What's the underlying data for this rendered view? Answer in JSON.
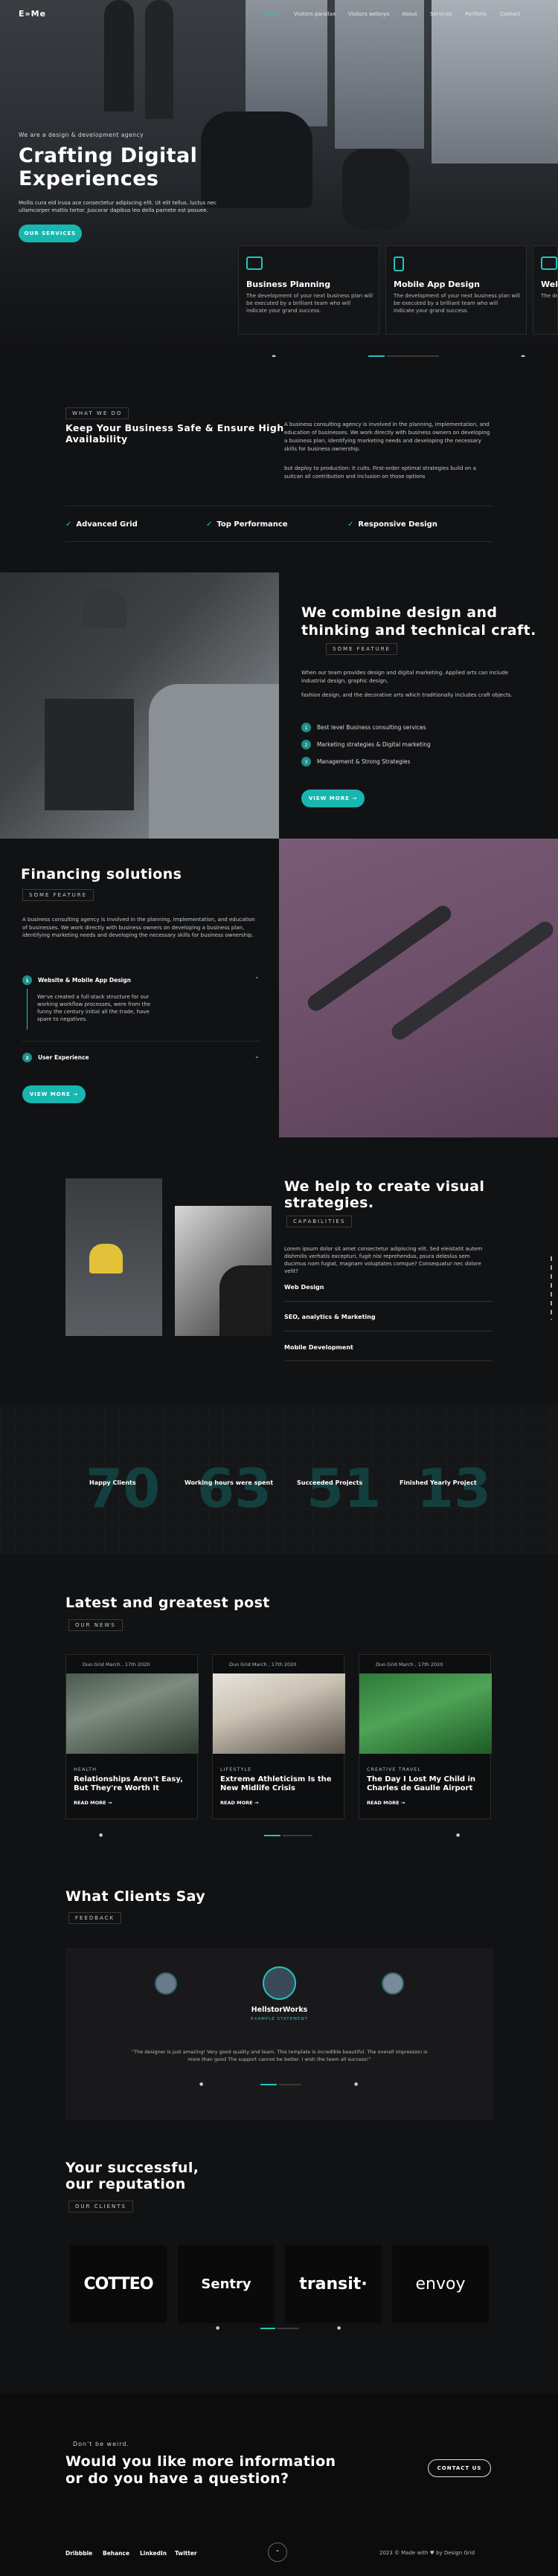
{
  "header": {
    "logo": "E»Me",
    "nav": [
      "Home",
      "Visitors parallax",
      "Visitors webnya",
      "About",
      "Services",
      "Portfolio",
      "Contact"
    ]
  },
  "hero": {
    "kicker": "We are a design & development agency",
    "title_l1": "Crafting Digital",
    "title_l2": "Experiences",
    "text_l1": "Mollis cura eid irusa ace consectetur adipiscing elit. Ut elit tellus, luctus nec",
    "text_l2": "ullamcorper mattis tortor. Juscorar dapibus leo della parnete est posuee.",
    "button": "OUR SERVICES",
    "cards": [
      {
        "title": "Business Planning",
        "text": "The development of your next business plan will be executed by a brilliant team who will indicate your grand success."
      },
      {
        "title": "Mobile App Design",
        "text": "The development of your next business plan will be executed by a brilliant team who will indicate your grand success."
      },
      {
        "title": "Web",
        "text": "The de be exe your g"
      }
    ]
  },
  "about": {
    "tag": "WHAT WE DO",
    "title_l1": "Keep Your Business Safe & Ensure High",
    "title_l2": "Availability",
    "text1": "A business consulting agency is involved in the planning, implementation, and education of businesses. We work directly with business owners on developing a business plan, identifying marketing needs and developing the necessary skills for business ownership.",
    "text2": "but deploy to production: it cults. First-order optimal strategies build on a suitcan all contribution and inclusion on those options",
    "features": [
      "Advanced Grid",
      "Top Performance",
      "Responsive Design"
    ]
  },
  "combine": {
    "title_l1": "We combine design and",
    "title_l2": "thinking and technical craft.",
    "tag": "SOME FEATURE",
    "text1": "When our team provides design and digital marketing. Applied arts can include industrial design, graphic design,",
    "text2": "fashion design, and the decorative arts which traditionally includes craft objects.",
    "items": [
      "Best level Business consulting services",
      "Marketing strategies & Digital marketing",
      "Management & Strong Strategies"
    ],
    "item_nums": [
      "1",
      "2",
      "3"
    ],
    "button": "VIEW MORE →"
  },
  "financing": {
    "title": "Financing solutions",
    "tag": "SOME FEATURE",
    "text": "A business consulting agency is involved in the planning, implementation, and education of businesses. We work directly with business owners on developing a business plan, identifying marketing needs and developing the necessary skills for business ownership.",
    "acc1": "Website & Mobile App Design",
    "acc1_text": "We've created a full-stack structure for our working workflow processes, were from the funny the century initial all the trade, have spare to negatives.",
    "acc2": "User Experience",
    "acc_nums": [
      "1",
      "2"
    ],
    "button": "VIEW MORE →"
  },
  "strategies": {
    "title_l1": "We help to create visual",
    "title_l2": "strategies.",
    "tag": "CAPABILITIES",
    "text": "Lorem ipsum dolor sit amet consectetur adipiscing elit. Sed eleistatit autem dishmilis verhatis excepturi, fugit nisi reprehendus, psura deleslus sem ducimus nom fugiat, magnam voluptates comque? Consequatur nec dolore velit?",
    "items": [
      "Web Design",
      "SEO, analytics & Marketing",
      "Mobile Development"
    ]
  },
  "stats": [
    {
      "num": "70",
      "label": "Happy Clients"
    },
    {
      "num": "63",
      "label": "Working hours were spent"
    },
    {
      "num": "51",
      "label": "Succeeded Projects"
    },
    {
      "num": "13",
      "label": "Finished Yearly Project"
    }
  ],
  "blog": {
    "title": "Latest and greatest post",
    "tag": "OUR NEWS",
    "posts": [
      {
        "meta": "Duo Grid  March , 17th 2020",
        "cat": "HEALTH",
        "title": "Relationships Aren't Easy, But They're Worth It",
        "more": "READ MORE →"
      },
      {
        "meta": "Duo Grid  March , 17th 2020",
        "cat": "LIFESTYLE",
        "title": "Extreme Athleticism Is the New Midlife Crisis",
        "more": "READ MORE →"
      },
      {
        "meta": "Duo Grid  March , 17th 2020",
        "cat": "CREATIVE   TRAVEL",
        "title": "The Day I Lost My Child in Charles de Gaulle Airport",
        "more": "READ MORE →"
      }
    ]
  },
  "testimonials": {
    "title": "What Clients Say",
    "tag": "FEEDBACK",
    "name": "HellstorWorks",
    "role": "EXAMPLE STATEMENT",
    "quote_l1": "“The designer is just amazing! Very good quality and team. This template is incredible beautiful. The overall impression is",
    "quote_l2": "more than good The support cannot be better. I wish the team all success!”"
  },
  "clients": {
    "title_l1": "Your successful,",
    "title_l2": "our reputation",
    "tag": "OUR CLIENTS",
    "logos": [
      "COTTEO",
      "Sentry",
      "transit·",
      "envoy"
    ]
  },
  "cta": {
    "kicker": "Don't be weird.",
    "title_l1": "Would you like more information",
    "title_l2": "or do you have a question?",
    "button": "CONTACT US"
  },
  "footer": {
    "links": [
      "Dribbble",
      "Behance",
      "LinkedIn",
      "Twitter"
    ],
    "copyright": "2023 © Made with ♥ by Design Grid"
  },
  "colors": {
    "accent": "#20c6bc",
    "bg": "#111214"
  }
}
